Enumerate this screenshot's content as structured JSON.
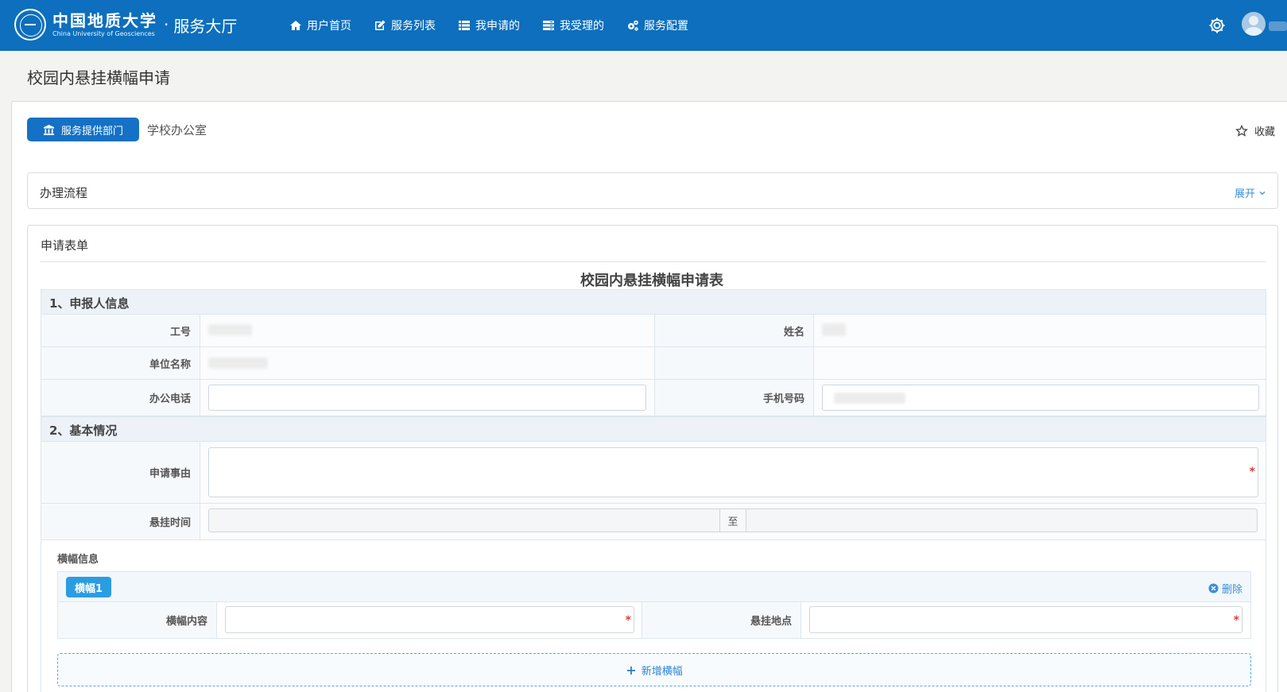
{
  "header": {
    "logo_cn": "中国地质大学",
    "logo_en": "China University of Geosciences",
    "logo_dot": "·",
    "hall": "服务大厅",
    "nav": [
      {
        "label": "用户首页",
        "icon": "home-icon"
      },
      {
        "label": "服务列表",
        "icon": "edit-icon"
      },
      {
        "label": "我申请的",
        "icon": "list-icon"
      },
      {
        "label": "我受理的",
        "icon": "tasks-icon"
      },
      {
        "label": "服务配置",
        "icon": "cogs-icon"
      }
    ]
  },
  "page": {
    "title": "校园内悬挂横幅申请",
    "dept_button": "服务提供部门",
    "dept_name": "学校办公室",
    "favorite": "收藏"
  },
  "process": {
    "title": "办理流程",
    "toggle": "展开"
  },
  "form": {
    "card_title": "申请表单",
    "title": "校园内悬挂横幅申请表",
    "section1": "1、申报人信息",
    "work_id_label": "工号",
    "name_label": "姓名",
    "unit_label": "单位名称",
    "office_phone_label": "办公电话",
    "mobile_label": "手机号码",
    "section2": "2、基本情况",
    "reason_label": "申请事由",
    "time_label": "悬挂时间",
    "time_sep": "至",
    "required_mark": "*",
    "banner_info_label": "横幅信息",
    "banners": [
      {
        "tag": "横幅1",
        "delete_label": "删除",
        "content_label": "横幅内容",
        "location_label": "悬挂地点"
      }
    ],
    "add_banner": "新增横幅"
  },
  "colors": {
    "header_bg": "#0d6fbd",
    "accent": "#1471c5",
    "link": "#3a8fd6",
    "required": "#e03c3c"
  }
}
